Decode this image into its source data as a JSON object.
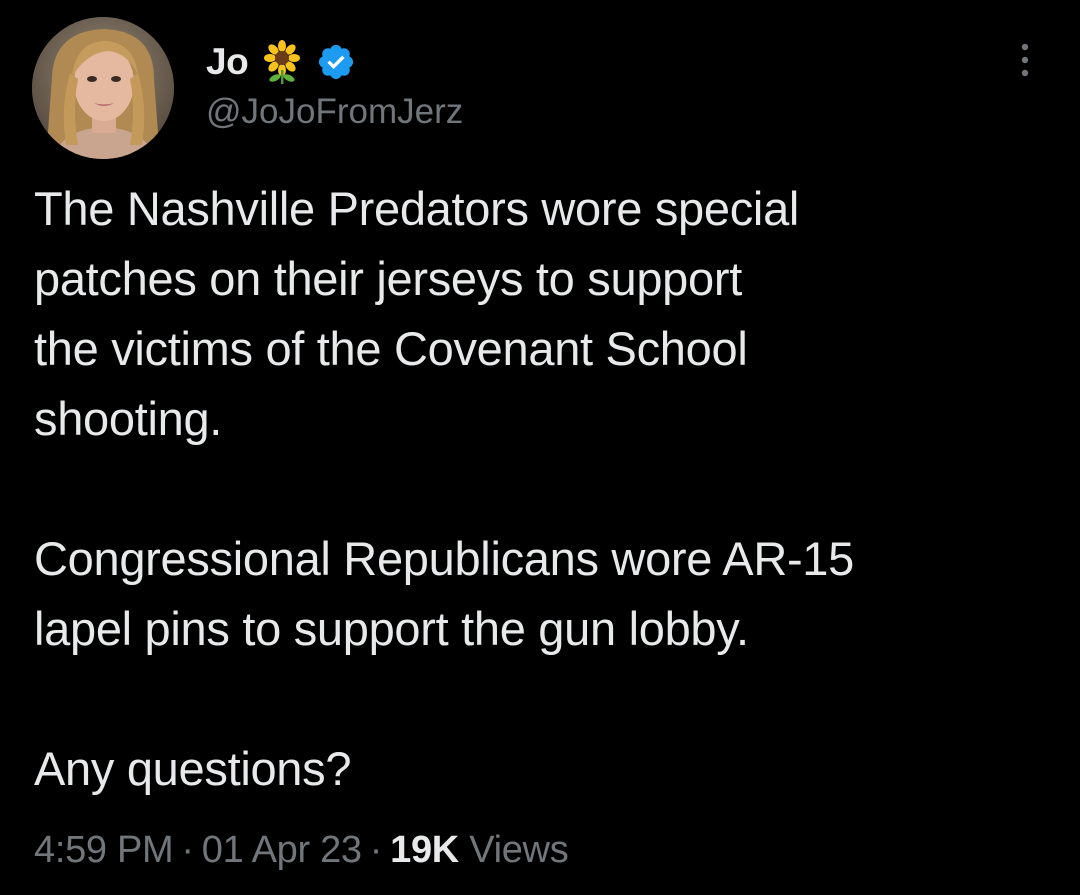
{
  "author": {
    "display_name": "Jo",
    "handle": "@JoJoFromJerz",
    "badge_emoji": "sunflower-icon",
    "verified_icon": "verified-icon",
    "verified_color": "#1d9bf0"
  },
  "tweet": {
    "paragraphs": [
      "The Nashville Predators wore special\npatches on their jerseys to support\nthe victims of the Covenant School\nshooting.",
      "Congressional Republicans wore AR-15\nlapel pins to support the gun lobby.",
      "Any questions?"
    ],
    "time": "4:59 PM",
    "date": "01 Apr 23",
    "separator": "·",
    "views_count": "19K",
    "views_label": "Views"
  },
  "menu": {
    "more_icon": "more-options-icon"
  },
  "colors": {
    "background": "#000000",
    "primary_text": "#e7e9ea",
    "secondary_text": "#71767b"
  }
}
